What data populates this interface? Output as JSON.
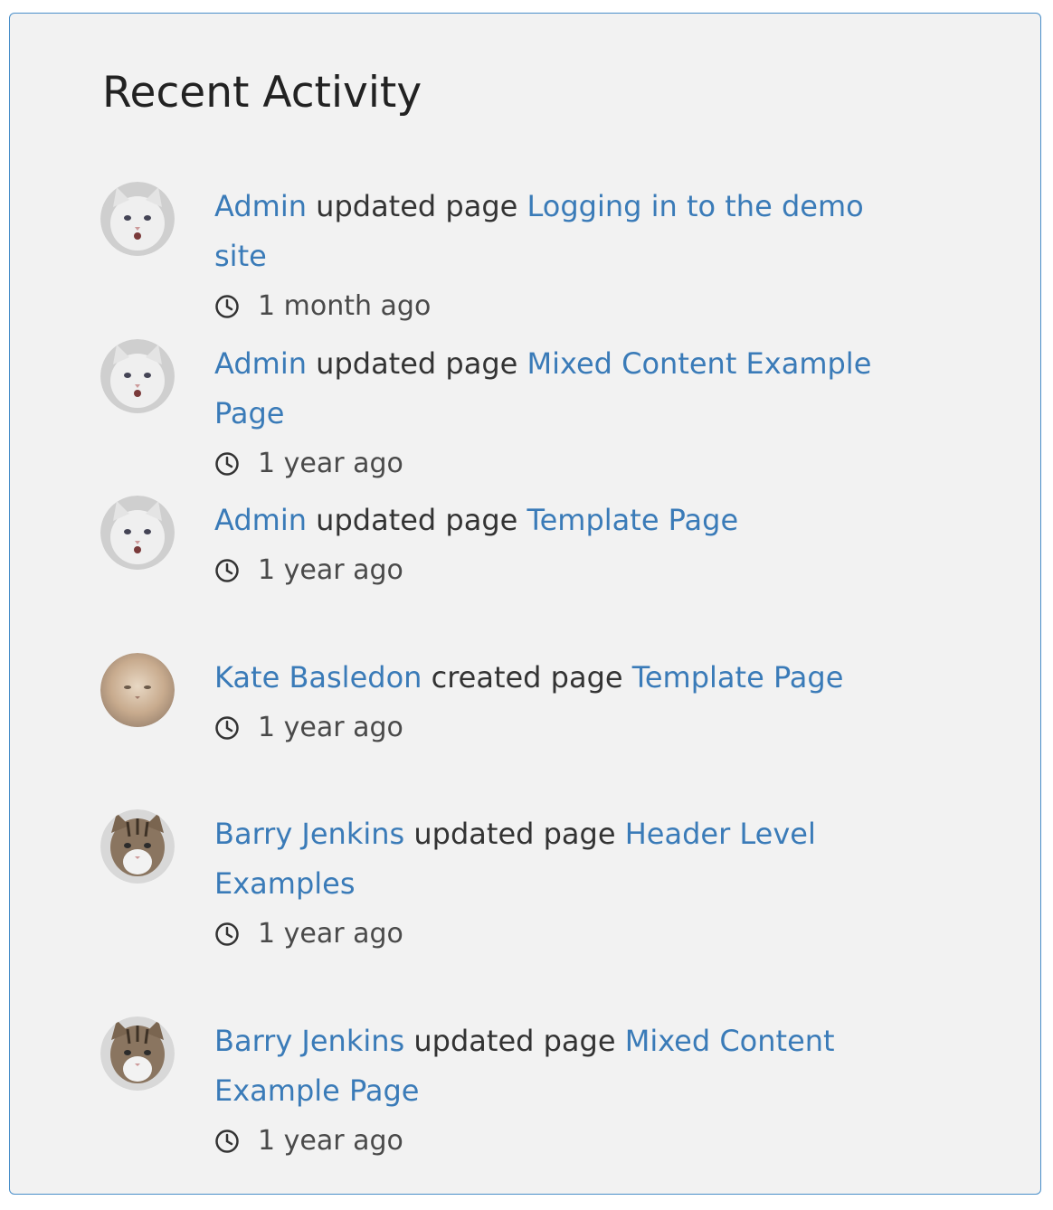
{
  "widget": {
    "title": "Recent Activity"
  },
  "activities": [
    {
      "user": "Admin",
      "action": "updated page",
      "page": "Logging in to the demo site",
      "time": "1 month ago",
      "avatar": "white-cat-avatar"
    },
    {
      "user": "Admin",
      "action": "updated page",
      "page": "Mixed Content Example Page",
      "time": "1 year ago",
      "avatar": "white-cat-avatar"
    },
    {
      "user": "Admin",
      "action": "updated page",
      "page": "Template Page",
      "time": "1 year ago",
      "avatar": "white-cat-avatar"
    },
    {
      "user": "Kate Basledon",
      "action": "created page",
      "page": "Template Page",
      "time": "1 year ago",
      "avatar": "fluffy-cat-avatar"
    },
    {
      "user": "Barry Jenkins",
      "action": "updated page",
      "page": "Header Level Examples",
      "time": "1 year ago",
      "avatar": "tabby-cat-avatar"
    },
    {
      "user": "Barry Jenkins",
      "action": "updated page",
      "page": "Mixed Content Example Page",
      "time": "1 year ago",
      "avatar": "tabby-cat-avatar"
    }
  ],
  "colors": {
    "link": "#3a7bb8",
    "text": "#333333",
    "background": "#f2f2f2",
    "border": "#4a8fc9"
  },
  "icons": {
    "time": "clock-icon"
  }
}
